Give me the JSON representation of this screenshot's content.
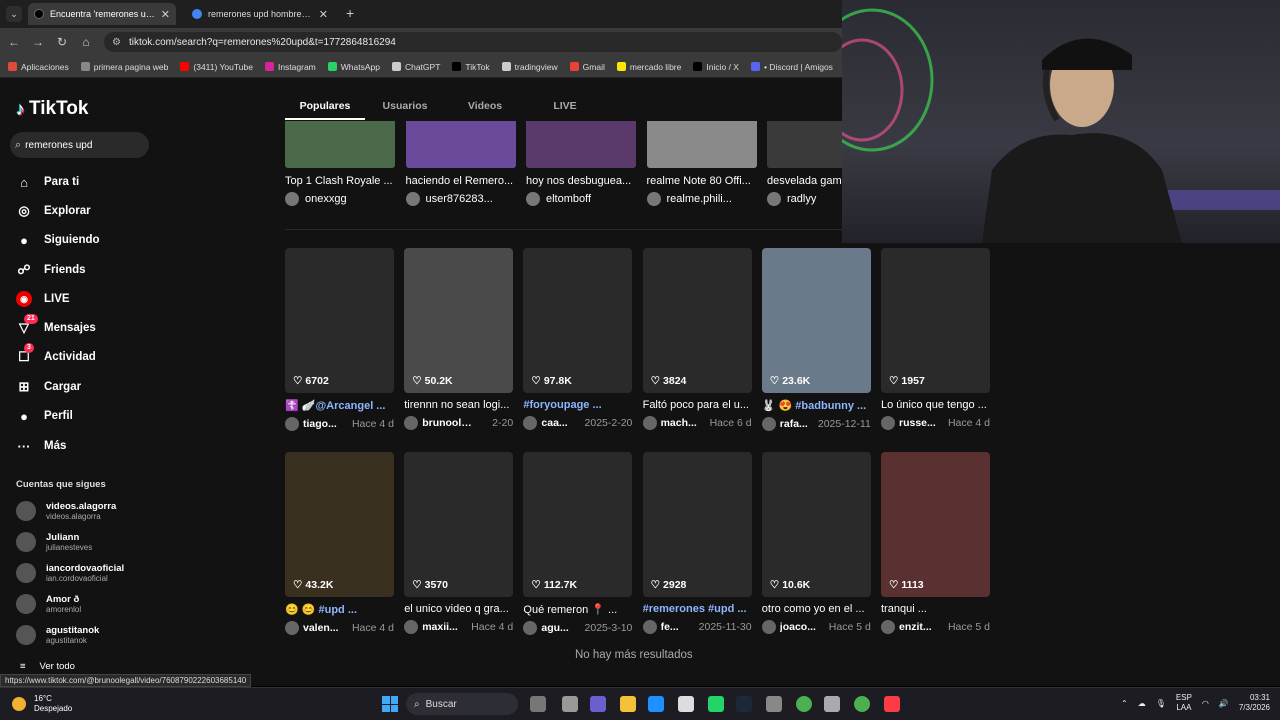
{
  "browser": {
    "tabs": [
      {
        "title": "Encuentra 'remerones upd' en",
        "favicon_color": "#000000",
        "active": true
      },
      {
        "title": "remerones upd hombre - Busca",
        "favicon_color": "#4285f4",
        "active": false
      }
    ],
    "url": "tiktok.com/search?q=remerones%20upd&t=1772864816294",
    "bookmarks": [
      {
        "label": "Aplicaciones",
        "color": "#e04a3a"
      },
      {
        "label": "primera pagina web",
        "color": "#888888"
      },
      {
        "label": "(3411) YouTube",
        "color": "#ff0000"
      },
      {
        "label": "Instagram",
        "color": "#d6249f"
      },
      {
        "label": "WhatsApp",
        "color": "#25d366"
      },
      {
        "label": "ChatGPT",
        "color": "#cccccc"
      },
      {
        "label": "TikTok",
        "color": "#000000"
      },
      {
        "label": "tradingview",
        "color": "#cccccc"
      },
      {
        "label": "Gmail",
        "color": "#ea4335"
      },
      {
        "label": "mercado libre",
        "color": "#ffe600"
      },
      {
        "label": "Inicio / X",
        "color": "#000000"
      },
      {
        "label": "• Discord | Amigos",
        "color": "#5865f2"
      }
    ]
  },
  "sidebar": {
    "logo": "TikTok",
    "search_value": "remerones upd",
    "nav": [
      {
        "label": "Para ti",
        "icon": "home-icon",
        "glyph": "⌂"
      },
      {
        "label": "Explorar",
        "icon": "compass-icon",
        "glyph": "◎"
      },
      {
        "label": "Siguiendo",
        "icon": "following-avatar-icon",
        "glyph": "●"
      },
      {
        "label": "Friends",
        "icon": "friends-icon",
        "glyph": "☍"
      },
      {
        "label": "LIVE",
        "icon": "live-icon",
        "glyph": "◉"
      },
      {
        "label": "Mensajes",
        "icon": "messages-icon",
        "glyph": "▽",
        "badge": "21"
      },
      {
        "label": "Actividad",
        "icon": "activity-icon",
        "glyph": "☐",
        "badge": "3"
      },
      {
        "label": "Cargar",
        "icon": "upload-icon",
        "glyph": "⊞"
      },
      {
        "label": "Perfil",
        "icon": "profile-icon",
        "glyph": "●"
      },
      {
        "label": "Más",
        "icon": "more-icon",
        "glyph": "···"
      }
    ],
    "following_title": "Cuentas que sigues",
    "accounts": [
      {
        "name": "videos.alagorra",
        "handle": "videos.alagorra"
      },
      {
        "name": "Juliann",
        "handle": "julianesteves"
      },
      {
        "name": "iancordovaoficial",
        "handle": "ian.cordovaoficial"
      },
      {
        "name": "Amor ð",
        "handle": "amorenlol"
      },
      {
        "name": "agustitanok",
        "handle": "agustitanok"
      }
    ],
    "see_all": "Ver todo"
  },
  "results_tabs": [
    "Populares",
    "Usuarios",
    "Videos",
    "LIVE"
  ],
  "top_row": [
    {
      "title": "Top 1 Clash Royale ...",
      "user": "onexxgg"
    },
    {
      "title": "haciendo el Remero...",
      "user": "user876283..."
    },
    {
      "title": "hoy nos desbuguea...",
      "user": "eltomboff"
    },
    {
      "title": "realme Note 80 Offi...",
      "user": "realme.phili..."
    },
    {
      "title": "desvelada gam",
      "user": "radlyy"
    }
  ],
  "row1": [
    {
      "likes": "6702",
      "title": "☦️ 🪽@Arcangel ...",
      "tag": true,
      "user": "tiago...",
      "date": "Hace 4 d"
    },
    {
      "likes": "50.2K",
      "title": "tirennn no sean logi...",
      "tag": false,
      "user": "brunoole...",
      "date": "2-20"
    },
    {
      "likes": "97.8K",
      "title": "#foryoupage ...",
      "tag": true,
      "user": "caa...",
      "date": "2025-2-20"
    },
    {
      "likes": "3824",
      "title": "Faltó poco para el u...",
      "tag": false,
      "user": "mach...",
      "date": "Hace 6 d"
    },
    {
      "likes": "23.6K",
      "title": "🐰 😍 #badbunny ...",
      "tag": true,
      "user": "rafa...",
      "date": "2025-12-11"
    },
    {
      "likes": "1957",
      "title": "Lo único que tengo ...",
      "tag": false,
      "user": "russe...",
      "date": "Hace 4 d"
    }
  ],
  "row2": [
    {
      "likes": "43.2K",
      "title": "😊 😊 #upd ...",
      "tag": true,
      "user": "valen...",
      "date": "Hace 4 d"
    },
    {
      "likes": "3570",
      "title": "el unico video q gra...",
      "tag": false,
      "user": "maxii...",
      "date": "Hace 4 d"
    },
    {
      "likes": "112.7K",
      "title": "Qué remeron 📍 ...",
      "tag": false,
      "user": "agu...",
      "date": "2025-3-10"
    },
    {
      "likes": "2928",
      "title": "#remerones #upd ...",
      "tag": true,
      "user": "fe...",
      "date": "2025-11-30"
    },
    {
      "likes": "10.6K",
      "title": "otro como yo en el ...",
      "tag": false,
      "user": "joaco...",
      "date": "Hace 5 d"
    },
    {
      "likes": "1113",
      "title": "tranqui ...",
      "tag": false,
      "user": "enzit...",
      "date": "Hace 5 d"
    }
  ],
  "no_more": "No hay más resultados",
  "status_url": "https://www.tiktok.com/@brunoolegall/video/7608790222603685140",
  "taskbar": {
    "temp": "16°C",
    "weather": "Despejado",
    "search": "Buscar",
    "lang1": "ESP",
    "lang2": "LAA",
    "time": "03:31",
    "date": "7/3/2026"
  }
}
